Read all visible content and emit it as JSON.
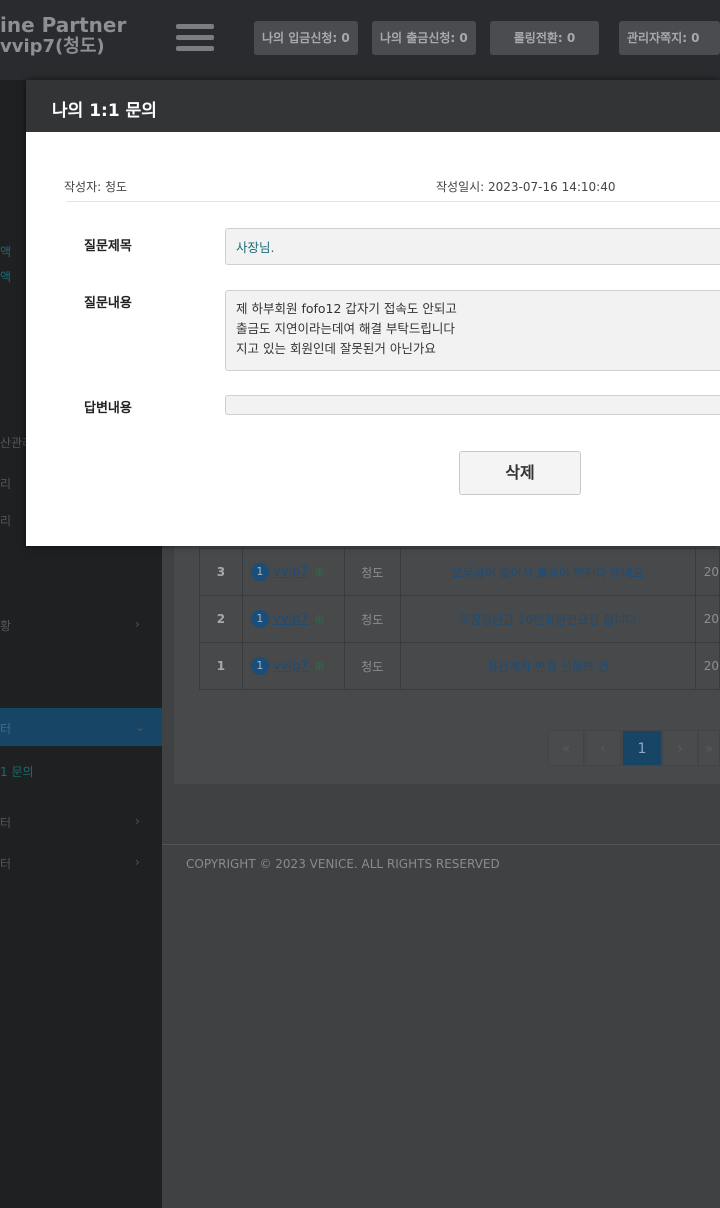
{
  "header": {
    "brand_line1": "ine Partner",
    "brand_line2": "vvip7(청도)",
    "buttons": [
      "나의 입금신청: 0",
      "나의 출금신청: 0",
      "롤링전환: 0",
      "관리자쪽지: 0"
    ]
  },
  "sidebar": {
    "items": [
      "액",
      "액",
      "산관리",
      "리",
      "리",
      "황",
      "터",
      "1 문의",
      "터",
      "터"
    ]
  },
  "table": {
    "rows": [
      {
        "num": "3",
        "badge": "1",
        "user": "vvip7",
        "name": "청도",
        "title": "보유금이 없어서 출금이 안된다 뜨네요",
        "date": "20"
      },
      {
        "num": "2",
        "badge": "1",
        "user": "vvip7",
        "name": "청도",
        "title": "죽장정산금 10만워환전요청 합니다",
        "date": "20"
      },
      {
        "num": "1",
        "badge": "1",
        "user": "vvip7",
        "name": "청도",
        "title": "정산계좌 변경 신청의 건",
        "date": "20"
      }
    ]
  },
  "pagination": {
    "first": "«",
    "prev": "‹",
    "current": "1",
    "next": "›",
    "last": "»"
  },
  "footer": {
    "copyright": "COPYRIGHT © 2023 VENICE. ALL RIGHTS RESERVED"
  },
  "modal": {
    "title": "나의 1:1 문의",
    "author": "작성자: 청도",
    "created": "작성일시: 2023-07-16 14:10:40",
    "subject_label": "질문제목",
    "subject_value": "사장님.",
    "content_label": "질문내용",
    "content_lines": [
      "제 하부회원 fofo12 갑자기 접속도 안되고",
      "출금도 지연이라는데여 해결 부탁드립니다",
      "지고 있는 회원인데 잘못된거 아닌가요"
    ],
    "answer_label": "답변내용",
    "answer_value": "",
    "delete_label": "삭제"
  }
}
